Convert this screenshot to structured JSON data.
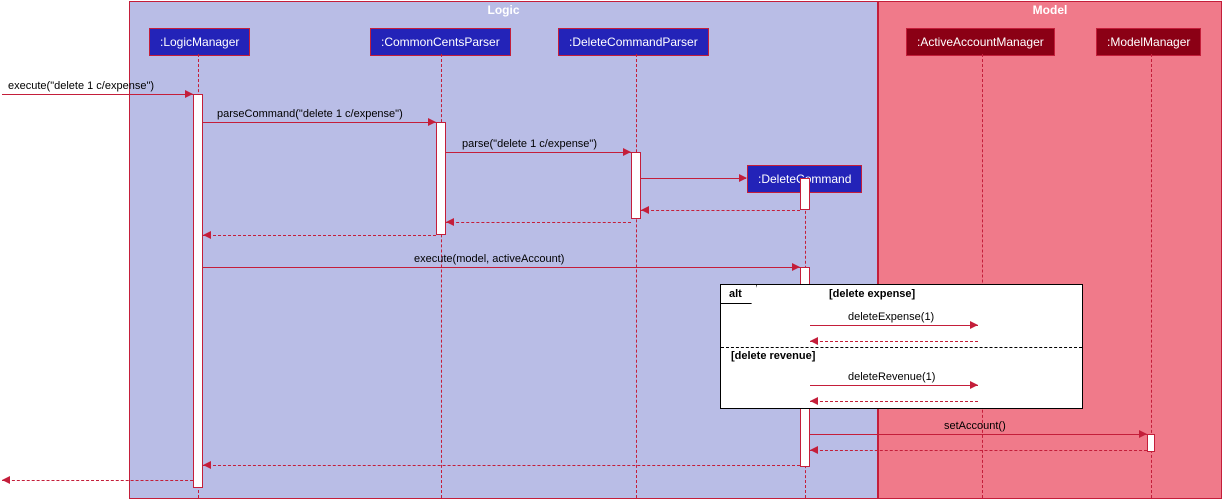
{
  "frames": {
    "logic": {
      "title": "Logic"
    },
    "model": {
      "title": "Model"
    }
  },
  "participants": {
    "logicManager": ":LogicManager",
    "commonCentsParser": ":CommonCentsParser",
    "deleteCommandParser": ":DeleteCommandParser",
    "deleteCommand": ":DeleteCommand",
    "activeAccountManager": ":ActiveAccountManager",
    "modelManager": ":ModelManager"
  },
  "messages": {
    "execute1": "execute(\"delete 1 c/expense\")",
    "parseCommand": "parseCommand(\"delete 1 c/expense\")",
    "parse": "parse(\"delete 1 c/expense\")",
    "execute2": "execute(model, activeAccount)",
    "deleteExpense": "deleteExpense(1)",
    "deleteRevenue": "deleteRevenue(1)",
    "setAccount": "setAccount()"
  },
  "alt": {
    "label": "alt",
    "cond1": "[delete expense]",
    "cond2": "[delete revenue]"
  },
  "chart_data": {
    "type": "sequence_diagram",
    "frames": [
      {
        "name": "Logic",
        "participants": [
          "LogicManager",
          "CommonCentsParser",
          "DeleteCommandParser",
          "DeleteCommand"
        ]
      },
      {
        "name": "Model",
        "participants": [
          "ActiveAccountManager",
          "ModelManager"
        ]
      }
    ],
    "participants": [
      ":LogicManager",
      ":CommonCentsParser",
      ":DeleteCommandParser",
      ":DeleteCommand",
      ":ActiveAccountManager",
      ":ModelManager"
    ],
    "messages": [
      {
        "from": "external",
        "to": "LogicManager",
        "label": "execute(\"delete 1 c/expense\")",
        "type": "sync"
      },
      {
        "from": "LogicManager",
        "to": "CommonCentsParser",
        "label": "parseCommand(\"delete 1 c/expense\")",
        "type": "sync"
      },
      {
        "from": "CommonCentsParser",
        "to": "DeleteCommandParser",
        "label": "parse(\"delete 1 c/expense\")",
        "type": "sync"
      },
      {
        "from": "DeleteCommandParser",
        "to": "DeleteCommand",
        "label": "",
        "type": "create"
      },
      {
        "from": "DeleteCommand",
        "to": "DeleteCommandParser",
        "label": "",
        "type": "return"
      },
      {
        "from": "DeleteCommandParser",
        "to": "CommonCentsParser",
        "label": "",
        "type": "return"
      },
      {
        "from": "CommonCentsParser",
        "to": "LogicManager",
        "label": "",
        "type": "return"
      },
      {
        "from": "LogicManager",
        "to": "DeleteCommand",
        "label": "execute(model, activeAccount)",
        "type": "sync"
      },
      {
        "alt": "alt",
        "conditions": [
          "delete expense",
          "delete revenue"
        ],
        "branches": [
          [
            {
              "from": "DeleteCommand",
              "to": "ActiveAccountManager",
              "label": "deleteExpense(1)",
              "type": "sync"
            },
            {
              "from": "ActiveAccountManager",
              "to": "DeleteCommand",
              "label": "",
              "type": "return"
            }
          ],
          [
            {
              "from": "DeleteCommand",
              "to": "ActiveAccountManager",
              "label": "deleteRevenue(1)",
              "type": "sync"
            },
            {
              "from": "ActiveAccountManager",
              "to": "DeleteCommand",
              "label": "",
              "type": "return"
            }
          ]
        ]
      },
      {
        "from": "DeleteCommand",
        "to": "ModelManager",
        "label": "setAccount()",
        "type": "sync"
      },
      {
        "from": "ModelManager",
        "to": "DeleteCommand",
        "label": "",
        "type": "return"
      },
      {
        "from": "DeleteCommand",
        "to": "LogicManager",
        "label": "",
        "type": "return"
      },
      {
        "from": "LogicManager",
        "to": "external",
        "label": "",
        "type": "return"
      }
    ]
  }
}
